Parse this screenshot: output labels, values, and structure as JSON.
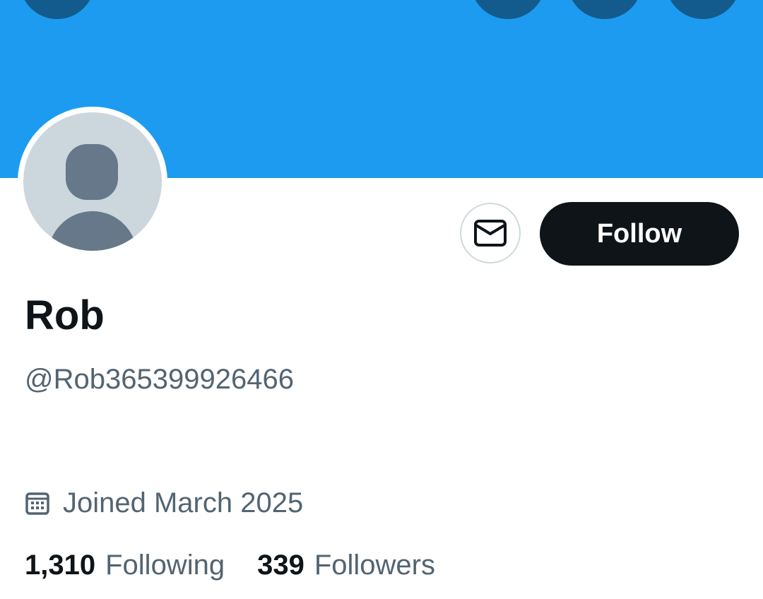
{
  "profile": {
    "display_name": "Rob",
    "handle": "@Rob365399926466",
    "joined": "Joined March 2025",
    "follow_label": "Follow",
    "stats": {
      "following_count": "1,310",
      "following_label": "Following",
      "followers_count": "339",
      "followers_label": "Followers"
    }
  },
  "icons": {
    "message": "mail-icon",
    "calendar": "calendar-icon",
    "avatar": "default-avatar-icon"
  },
  "colors": {
    "banner": "#1d9bf0",
    "top_buttons": "#135b8d",
    "follow_button": "#0f1419",
    "secondary_text": "#536471",
    "primary_text": "#0f1419"
  }
}
